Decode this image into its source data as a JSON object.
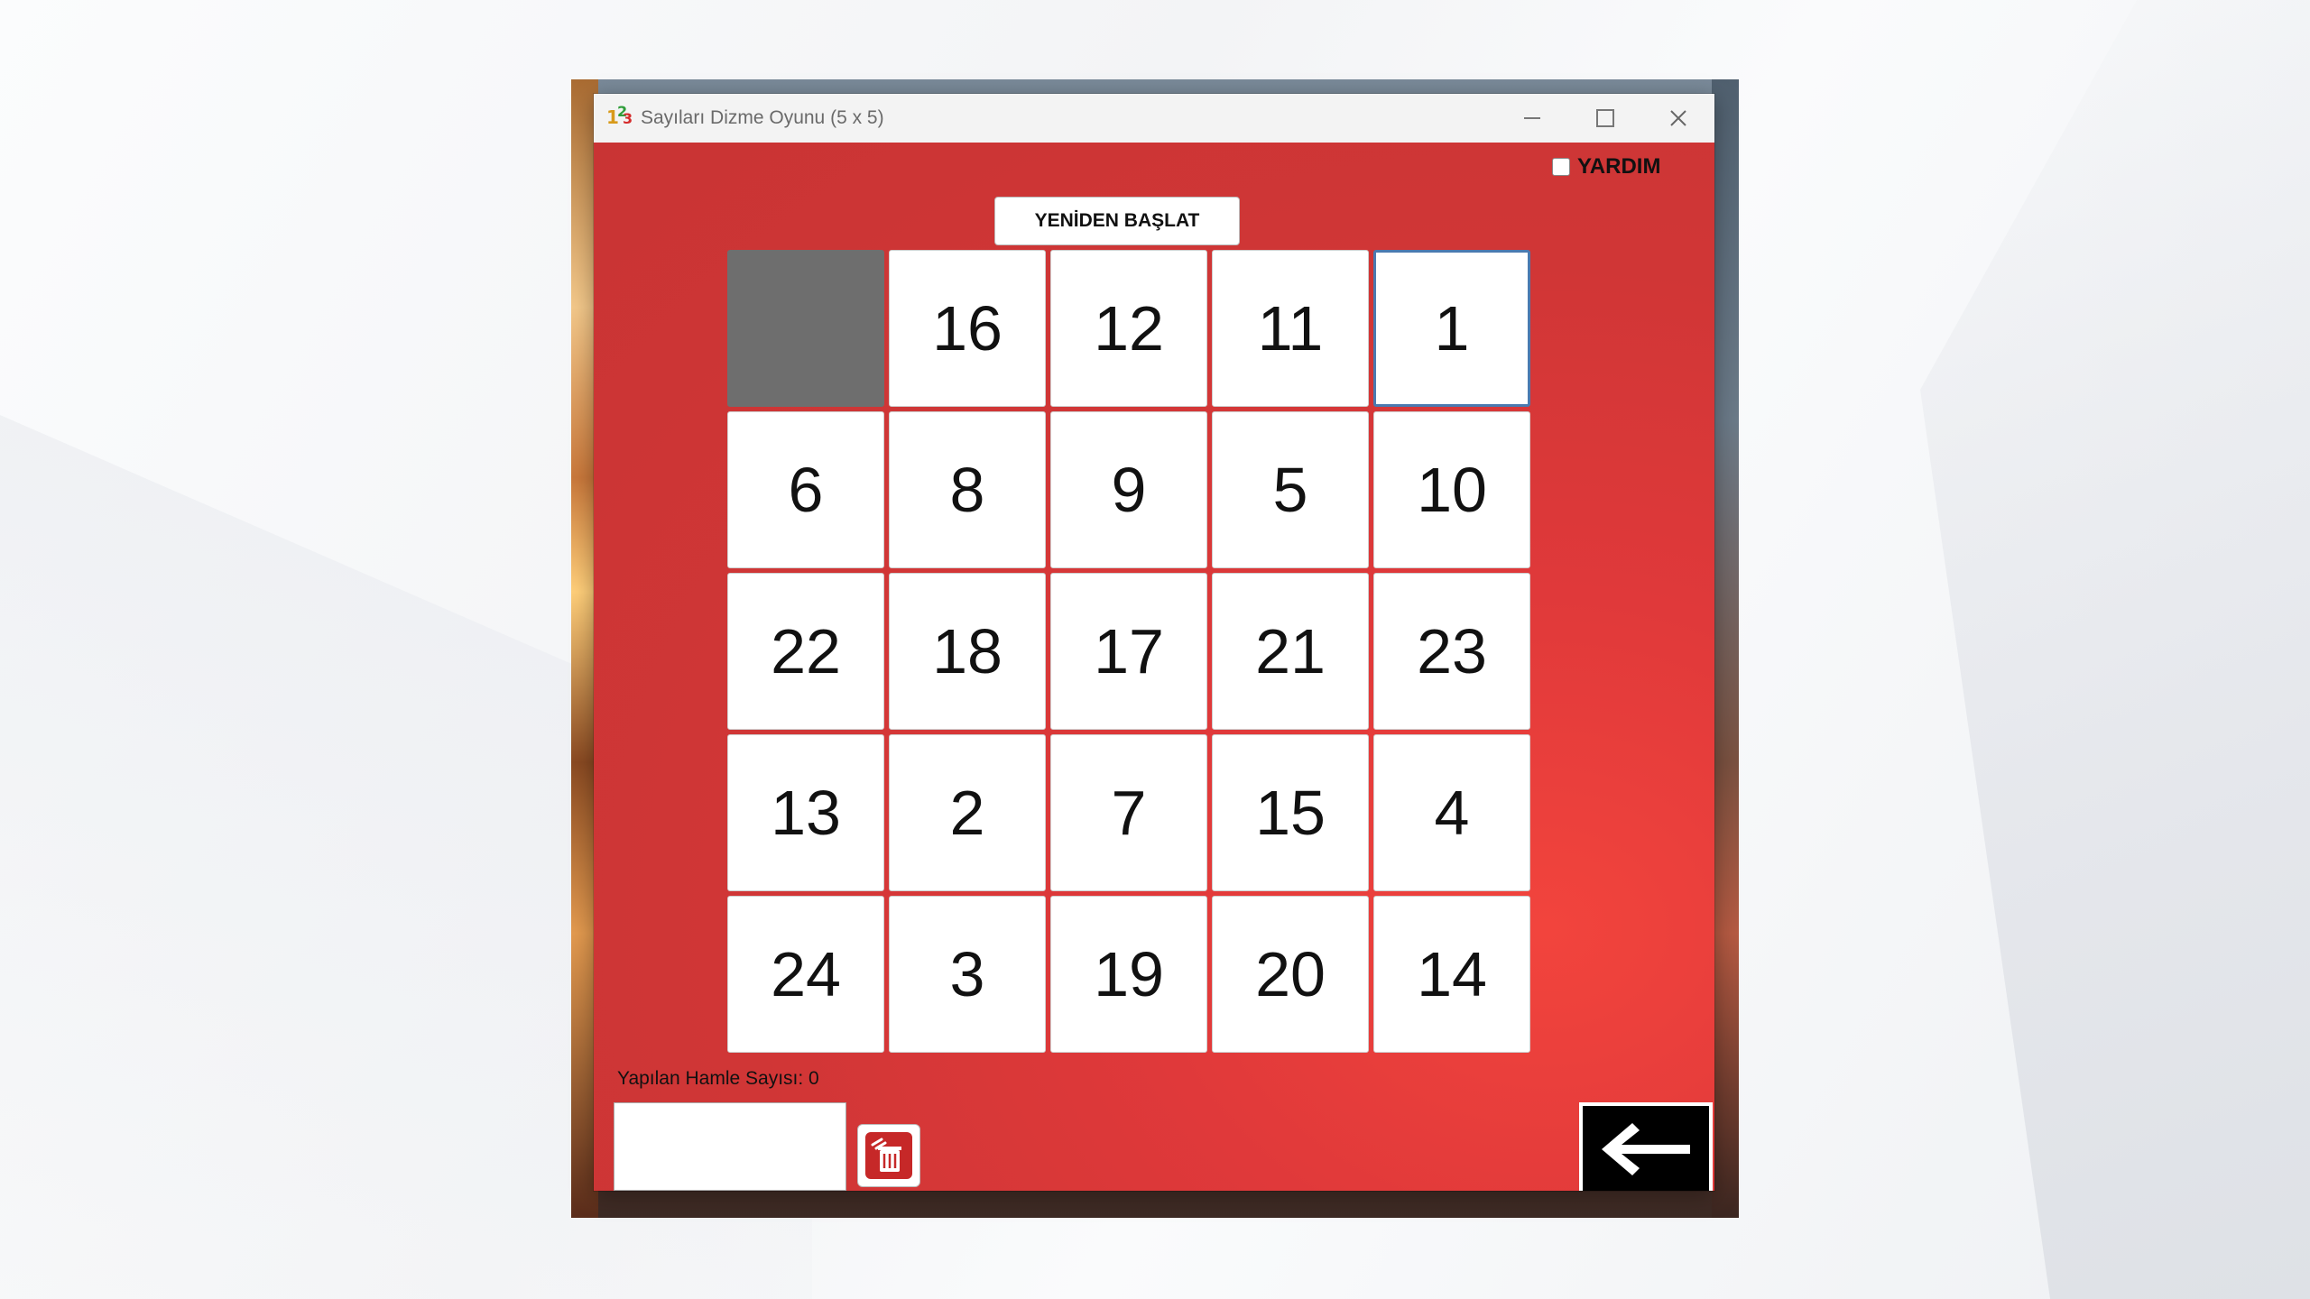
{
  "window": {
    "title": "Sayıları Dizme Oyunu (5 x 5)"
  },
  "help": {
    "label": "YARDIM",
    "checked": false
  },
  "restart": {
    "label": "YENİDEN BAŞLAT"
  },
  "board": {
    "rows": 5,
    "cols": 5,
    "tiles": [
      "",
      "16",
      "12",
      "11",
      "1",
      "6",
      "8",
      "9",
      "5",
      "10",
      "22",
      "18",
      "17",
      "21",
      "23",
      "13",
      "2",
      "7",
      "15",
      "4",
      "24",
      "3",
      "19",
      "20",
      "14"
    ],
    "empty_index": 0,
    "selected_index": 4
  },
  "status": {
    "moves_label": "Yapılan Hamle Sayısı: 0"
  },
  "name_input": {
    "value": ""
  },
  "icons": {
    "trash": "trash-icon",
    "back": "arrow-left-icon"
  },
  "colors": {
    "panel_red": "#d03636",
    "empty_tile": "#6e6e6e",
    "selected_border": "#4a7ab0"
  }
}
